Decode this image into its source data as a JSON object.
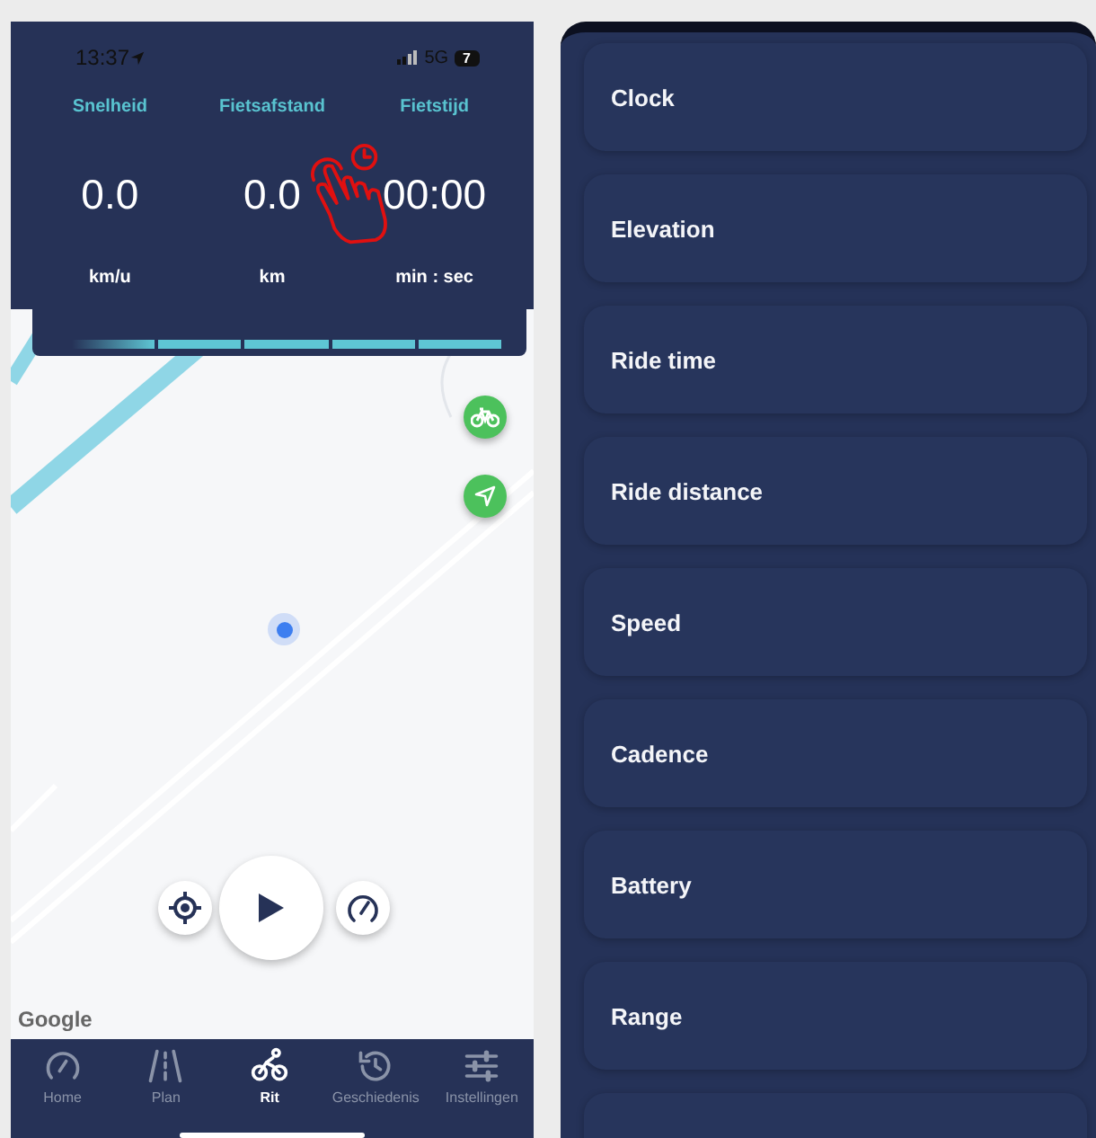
{
  "status_bar": {
    "time": "13:37",
    "network": "5G",
    "battery": "7"
  },
  "stats": [
    {
      "label": "Snelheid",
      "value": "0.0",
      "unit": "km/u"
    },
    {
      "label": "Fietsafstand",
      "value": "0.0",
      "unit": "km"
    },
    {
      "label": "Fietstijd",
      "value": "00:00",
      "unit": "min : sec"
    }
  ],
  "map": {
    "attribution": "Google"
  },
  "nav": [
    {
      "label": "Home",
      "kind": "gauge",
      "selected": false
    },
    {
      "label": "Plan",
      "kind": "road",
      "selected": false
    },
    {
      "label": "Rit",
      "kind": "cyclist",
      "selected": true
    },
    {
      "label": "Geschiedenis",
      "kind": "history",
      "selected": false
    },
    {
      "label": "Instellingen",
      "kind": "sliders",
      "selected": false
    }
  ],
  "widget_list": [
    {
      "label": "Clock"
    },
    {
      "label": "Elevation"
    },
    {
      "label": "Ride time"
    },
    {
      "label": "Ride distance"
    },
    {
      "label": "Speed"
    },
    {
      "label": "Cadence"
    },
    {
      "label": "Battery"
    },
    {
      "label": "Range"
    }
  ]
}
